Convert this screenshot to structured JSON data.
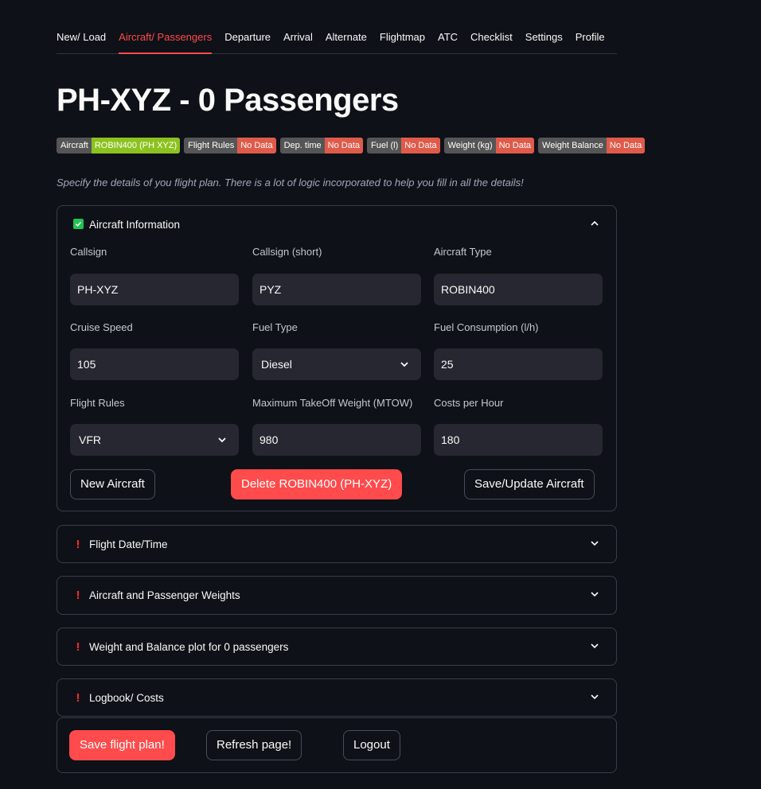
{
  "nav": {
    "tabs": [
      {
        "label": "New/ Load"
      },
      {
        "label": "Aircraft/ Passengers"
      },
      {
        "label": "Departure"
      },
      {
        "label": "Arrival"
      },
      {
        "label": "Alternate"
      },
      {
        "label": "Flightmap"
      },
      {
        "label": "ATC"
      },
      {
        "label": "Checklist"
      },
      {
        "label": "Settings"
      },
      {
        "label": "Profile"
      }
    ],
    "active_tab": "Aircraft/ Passengers"
  },
  "title": "PH-XYZ - 0 Passengers",
  "badges": [
    {
      "key": "Aircraft",
      "value": "ROBIN400 (PH XYZ)",
      "color": "#8cc21f"
    },
    {
      "key": "Flight Rules",
      "value": "No Data",
      "color": "#e05a4a"
    },
    {
      "key": "Dep. time",
      "value": "No Data",
      "color": "#e05a4a"
    },
    {
      "key": "Fuel (l)",
      "value": "No Data",
      "color": "#e05a4a"
    },
    {
      "key": "Weight (kg)",
      "value": "No Data",
      "color": "#e05a4a"
    },
    {
      "key": "Weight Balance",
      "value": "No Data",
      "color": "#e05a4a"
    }
  ],
  "subtitle": "Specify the details of you flight plan. There is a lot of logic incorporated to help you fill in all the details!",
  "aircraft_info": {
    "header": "Aircraft Information",
    "status_icon": "check-icon",
    "fields": {
      "callsign": {
        "label": "Callsign",
        "value": "PH-XYZ"
      },
      "callsign_short": {
        "label": "Callsign (short)",
        "value": "PYZ"
      },
      "aircraft_type": {
        "label": "Aircraft Type",
        "value": "ROBIN400"
      },
      "cruise_speed": {
        "label": "Cruise Speed",
        "value": "105"
      },
      "fuel_type": {
        "label": "Fuel Type",
        "value": "Diesel"
      },
      "fuel_consumption": {
        "label": "Fuel Consumption (l/h)",
        "value": "25"
      },
      "flight_rules": {
        "label": "Flight Rules",
        "value": "VFR"
      },
      "mtow": {
        "label": "Maximum TakeOff Weight (MTOW)",
        "value": "980"
      },
      "costs_per_hour": {
        "label": "Costs per Hour",
        "value": "180"
      }
    },
    "buttons": {
      "new": "New Aircraft",
      "delete": "Delete ROBIN400 (PH-XYZ)",
      "save": "Save/Update Aircraft"
    }
  },
  "sections": [
    {
      "label": "Flight Date/Time"
    },
    {
      "label": "Aircraft and Passenger Weights"
    },
    {
      "label": "Weight and Balance plot for 0 passengers"
    },
    {
      "label": "Logbook/ Costs"
    }
  ],
  "footer_buttons": {
    "save_plan": "Save flight plan!",
    "refresh": "Refresh page!",
    "logout": "Logout"
  },
  "colors": {
    "accent": "#ff4b4b",
    "background": "#0e1117",
    "input_bg": "#262730",
    "success": "#21c354"
  }
}
